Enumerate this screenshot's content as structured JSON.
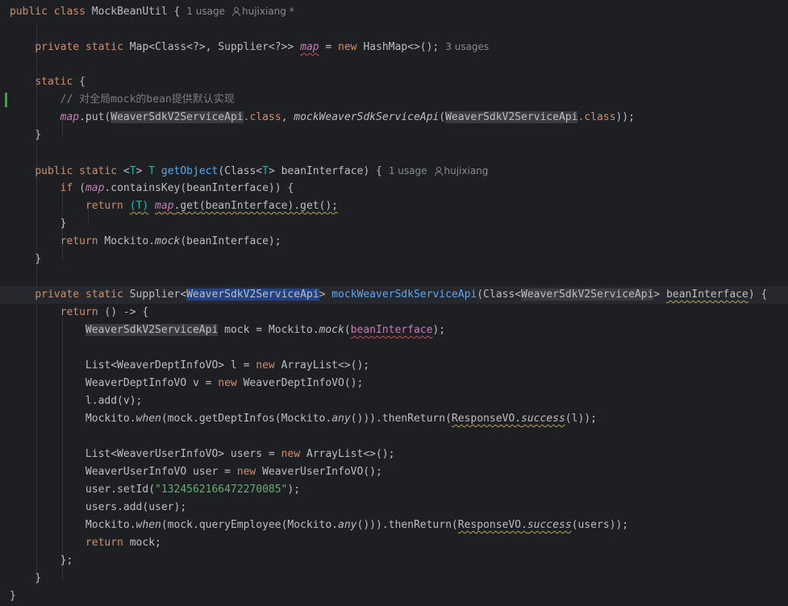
{
  "editor": {
    "class_decl": {
      "kw_public": "public",
      "kw_class": "class",
      "name": "MockBeanUtil",
      "brace": " {",
      "usages": "1 usage",
      "author": "hujixiang *"
    },
    "field": {
      "kw_private": "private",
      "kw_static": "static",
      "type": "Map<Class<?>, Supplier<?>>",
      "name": "map",
      "eq": " = ",
      "kw_new": "new",
      "init": " HashMap<>();",
      "usages": "3 usages"
    },
    "static_block": {
      "kw_static": "static",
      "brace": " {"
    },
    "comment": "// 对全局mock的bean提供默认实现",
    "put_call": {
      "recv": "map",
      "put": ".put(",
      "arg1": "WeaverSdkV2ServiceApi",
      "dot_class": ".class",
      "comma": ", ",
      "method": "mockWeaverSdkServiceApi",
      "open": "(",
      "arg2": "WeaverSdkV2ServiceApi",
      "dot_class2": ".class",
      "close": "));"
    },
    "close_brace": "}",
    "get_object": {
      "kw_public": "public",
      "kw_static": "static",
      "generic_open": "<",
      "T": "T",
      "generic_close": ">",
      "T_ret": "T",
      "name": "getObject",
      "params_a": "(Class<",
      "params_T": "T",
      "params_b": "> beanInterface) {",
      "usages": "1 usage",
      "author": "hujixiang"
    },
    "if_line": {
      "kw_if": "if",
      "open": " (",
      "recv": "map",
      "rest": ".containsKey(beanInterface)) {"
    },
    "return_cast": {
      "kw_return": "return",
      "cast": "(T)",
      "space": " ",
      "recv": "map",
      "rest": ".get(beanInterface).get();"
    },
    "return_mockito": {
      "kw_return": "return",
      "rest": " Mockito.",
      "method": "mock",
      "args": "(beanInterface);"
    },
    "supplier": {
      "kw_private": "private",
      "kw_static": "static",
      "type_a": "Supplier<",
      "type_sel": "WeaverSdkV2ServiceApi",
      "type_b": ">",
      "name": "mockWeaverSdkServiceApi",
      "params_a": "(Class<",
      "params_type": "WeaverSdkV2ServiceApi",
      "params_b": "> ",
      "param_name": "beanInterface",
      "params_c": ") {"
    },
    "return_lambda": {
      "kw_return": "return",
      "rest": " () -> {"
    },
    "mock_decl": {
      "type": "WeaverSdkV2ServiceApi",
      "mid": " mock = Mockito.",
      "method": "mock",
      "open": "(",
      "arg": "beanInterface",
      "close": ");"
    },
    "list_dept": {
      "decl": "List<WeaverDeptInfoVO> l = ",
      "kw_new": "new",
      "init": " ArrayList<>();"
    },
    "dept_vo": {
      "decl": "WeaverDeptInfoVO v = ",
      "kw_new": "new",
      "init": " WeaverDeptInfoVO();"
    },
    "add_v": "l.add(v);",
    "when_dept": {
      "a": "Mockito.",
      "when": "when",
      "b": "(mock.getDeptInfos(Mockito.",
      "any": "any",
      "c": "())).thenReturn(",
      "resp": "ResponseVO.",
      "success": "success",
      "d": "(l));"
    },
    "list_user": {
      "decl": "List<WeaverUserInfoVO> users = ",
      "kw_new": "new",
      "init": " ArrayList<>();"
    },
    "user_vo": {
      "decl": "WeaverUserInfoVO user = ",
      "kw_new": "new",
      "init": " WeaverUserInfoVO();"
    },
    "set_id": {
      "a": "user.setId(",
      "str": "\"1324562166472270085\"",
      "b": ");"
    },
    "add_user": "users.add(user);",
    "when_user": {
      "a": "Mockito.",
      "when": "when",
      "b": "(mock.queryEmployee(Mockito.",
      "any": "any",
      "c": "())).thenReturn(",
      "resp": "ResponseVO.",
      "success": "success",
      "d": "(users));"
    },
    "return_mock": {
      "kw_return": "return",
      "rest": " mock;"
    },
    "lambda_close": "};"
  },
  "colors": {
    "background": "#1e1f22",
    "keyword": "#cf8e6d",
    "field": "#c77dbb",
    "method_decl": "#56a8f5",
    "type_param": "#16baac",
    "string": "#6aab73",
    "comment": "#7a7e85",
    "selection": "#214283",
    "inlay_hint": "#868a91",
    "text": "#bcbec4"
  }
}
